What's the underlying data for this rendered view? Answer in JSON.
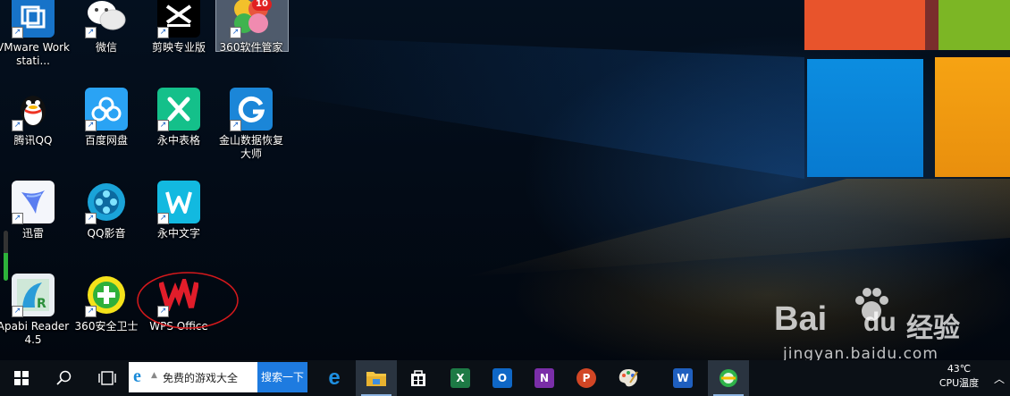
{
  "desktop": {
    "icons": [
      {
        "label": "VMware Workstati...",
        "icon": "vmware-icon"
      },
      {
        "label": "微信",
        "icon": "wechat-icon"
      },
      {
        "label": "剪映专业版",
        "icon": "capcut-icon"
      },
      {
        "label": "360软件管家",
        "icon": "360-software-manager-icon",
        "badge": "10"
      },
      {
        "label": "腾讯QQ",
        "icon": "qq-icon"
      },
      {
        "label": "百度网盘",
        "icon": "baidu-netdisk-icon"
      },
      {
        "label": "永中表格",
        "icon": "yozo-sheet-icon"
      },
      {
        "label": "金山数据恢复大师",
        "icon": "kingsoft-data-recovery-icon"
      },
      {
        "label": "迅雷",
        "icon": "thunder-icon"
      },
      {
        "label": "QQ影音",
        "icon": "qq-player-icon"
      },
      {
        "label": "永中文字",
        "icon": "yozo-writer-icon"
      },
      {
        "label": "Apabi Reader 4.5",
        "icon": "apabi-reader-icon"
      },
      {
        "label": "360安全卫士",
        "icon": "360-security-icon"
      },
      {
        "label": "WPS Office",
        "icon": "wps-office-icon"
      }
    ]
  },
  "watermark": {
    "brand": "Bai",
    "brand_suffix": "du",
    "cn": "经验",
    "url": "jingyan.baidu.com"
  },
  "taskbar": {
    "search_box": {
      "text": "免费的游戏大全",
      "button": "搜索一下"
    },
    "apps": [
      {
        "name": "edge",
        "icon": "edge-icon"
      },
      {
        "name": "file-explorer",
        "icon": "folder-icon"
      },
      {
        "name": "store",
        "icon": "store-icon"
      },
      {
        "name": "excel",
        "icon": "excel-icon",
        "letter": "X"
      },
      {
        "name": "outlook",
        "icon": "outlook-icon",
        "letter": "O"
      },
      {
        "name": "onenote",
        "icon": "onenote-icon",
        "letter": "N"
      },
      {
        "name": "powerpoint",
        "icon": "powerpoint-icon",
        "letter": "P"
      },
      {
        "name": "paint",
        "icon": "palette-icon"
      },
      {
        "name": "word",
        "icon": "word-icon",
        "letter": "W"
      },
      {
        "name": "360-browser",
        "icon": "360-browser-icon"
      }
    ],
    "tray": {
      "temp": "43℃",
      "temp_label": "CPU温度"
    }
  },
  "colors": {
    "accent": "#0a74da",
    "annotation": "#d7191c"
  }
}
